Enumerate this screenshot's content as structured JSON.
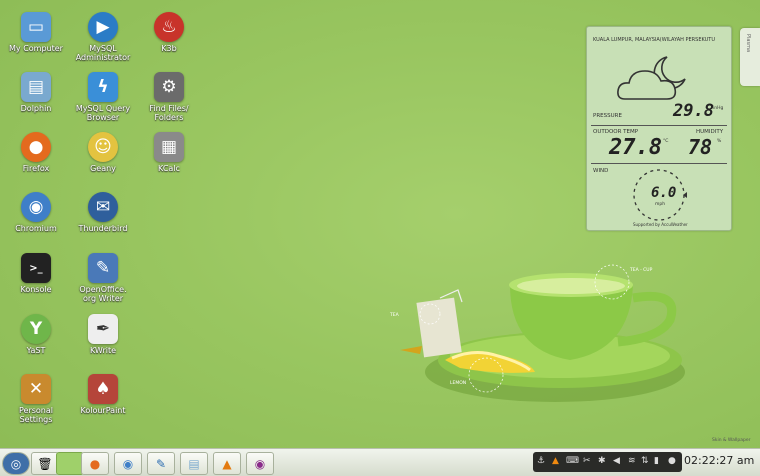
{
  "desktop_icons": [
    {
      "label": "My Computer",
      "icon": "computer-icon",
      "color": "#5a9ad6",
      "glyph": "▭"
    },
    {
      "label": "MySQL Administrator",
      "icon": "mysql-admin-icon",
      "color": "#2b7cc6",
      "glyph": "▶"
    },
    {
      "label": "K3b",
      "icon": "k3b-icon",
      "color": "#c8332a",
      "glyph": "♨"
    },
    {
      "label": "Dolphin",
      "icon": "dolphin-icon",
      "color": "#7aa9cf",
      "glyph": "▤"
    },
    {
      "label": "MySQL Query Browser",
      "icon": "mysql-query-icon",
      "color": "#3a8fd8",
      "glyph": "ϟ"
    },
    {
      "label": "Find Files/ Folders",
      "icon": "find-files-icon",
      "color": "#6b6b6b",
      "glyph": "⚙"
    },
    {
      "label": "Firefox",
      "icon": "firefox-icon",
      "color": "#e46a1e",
      "glyph": "●"
    },
    {
      "label": "Geany",
      "icon": "geany-icon",
      "color": "#e3c340",
      "glyph": "☺"
    },
    {
      "label": "KCalc",
      "icon": "kcalc-icon",
      "color": "#8a8a8a",
      "glyph": "▦"
    },
    {
      "label": "Chromium",
      "icon": "chromium-icon",
      "color": "#3f7fc8",
      "glyph": "◉"
    },
    {
      "label": "Thunderbird",
      "icon": "thunderbird-icon",
      "color": "#2f5f9c",
      "glyph": "✉"
    },
    {
      "label": "Konsole",
      "icon": "konsole-icon",
      "color": "#222222",
      "glyph": ">_"
    },
    {
      "label": "OpenOffice. org Writer",
      "icon": "writer-icon",
      "color": "#4a79b8",
      "glyph": "✎"
    },
    {
      "label": "YaST",
      "icon": "yast-icon",
      "color": "#6fb64a",
      "glyph": "🐘"
    },
    {
      "label": "KWrite",
      "icon": "kwrite-icon",
      "color": "#dddddd",
      "glyph": "✒"
    },
    {
      "label": "Personal Settings",
      "icon": "settings-icon",
      "color": "#c98a2e",
      "glyph": "✕"
    },
    {
      "label": "KolourPaint",
      "icon": "kolourpaint-icon",
      "color": "#b5453a",
      "glyph": "♠"
    }
  ],
  "weather": {
    "location": "KUALA LUMPUR, MALAYSIA(WILAYAH PERSEKUTU",
    "pressure_label": "PRESSURE",
    "pressure": "29.8",
    "pressure_unit": "inHg",
    "outdoor_label": "OUTDOOR TEMP",
    "outdoor": "27.8",
    "outdoor_unit": "°C",
    "humidity_label": "HUMIDITY",
    "humidity": "78",
    "humidity_unit": "%",
    "wind_label": "WIND",
    "wind": "6.0",
    "wind_unit": "mph",
    "footer": "Supported by AccuWeather"
  },
  "side_tab": "Plasma",
  "callouts": {
    "cup": "TEA - CUP",
    "tag": "TEA",
    "lemon": "LEMON",
    "credit": "Skin & Wallpaper"
  },
  "taskbar": {
    "launchers": [
      {
        "icon": "kickoff-icon"
      },
      {
        "icon": "trash-icon"
      },
      {
        "icon": "desktop-icon"
      },
      {
        "icon": "firefox-task-icon"
      },
      {
        "icon": "chromium-task-icon"
      },
      {
        "icon": "kate-task-icon"
      },
      {
        "icon": "dolphin-task-icon"
      },
      {
        "icon": "vlc-task-icon"
      },
      {
        "icon": "eye-task-icon"
      }
    ],
    "tray": [
      "anchor-icon",
      "vlc-tray-icon",
      "keyboard-icon",
      "scissors-icon",
      "bluetooth-icon",
      "volume-icon",
      "wifi-icon",
      "network-icon",
      "battery-icon",
      "notifications-icon"
    ],
    "clock": "02:22:27 am"
  }
}
